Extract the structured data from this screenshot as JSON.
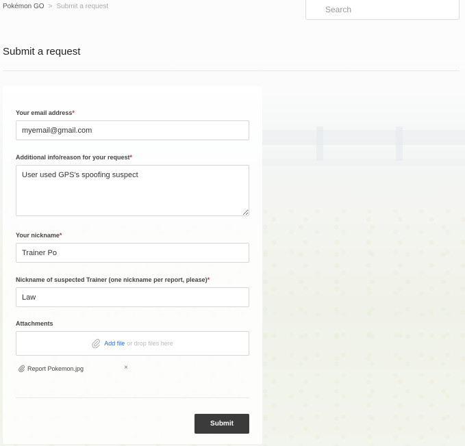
{
  "breadcrumb": {
    "home": "Pokémon GO",
    "separator": ">",
    "current": "Submit a request"
  },
  "search": {
    "placeholder": "Search",
    "value": ""
  },
  "page": {
    "title": "Submit a request"
  },
  "form": {
    "email": {
      "label": "Your email address",
      "required_mark": "*",
      "value": "myemail@gmail.com"
    },
    "reason": {
      "label": "Additional info/reason for your request",
      "required_mark": "*",
      "value": "User used GPS's spoofing suspect"
    },
    "nickname": {
      "label": "Your nickname",
      "required_mark": "*",
      "value": "Trainer Po"
    },
    "suspect_nickname": {
      "label": "Nickname of suspected Trainer (one nickname per report, please)",
      "required_mark": "*",
      "value": "Law"
    },
    "attachments": {
      "label": "Attachments",
      "add_file": "Add file",
      "drop_hint": "or drop files here",
      "files": [
        {
          "name": "Report Pokemon.jpg",
          "remove": "×"
        }
      ]
    },
    "submit_label": "Submit"
  },
  "colors": {
    "required": "#c0392b",
    "link": "#2a6ebb",
    "submit_bg": "#3b3b3b"
  },
  "icons": {
    "attach": "paperclip-icon",
    "remove": "close-icon"
  }
}
